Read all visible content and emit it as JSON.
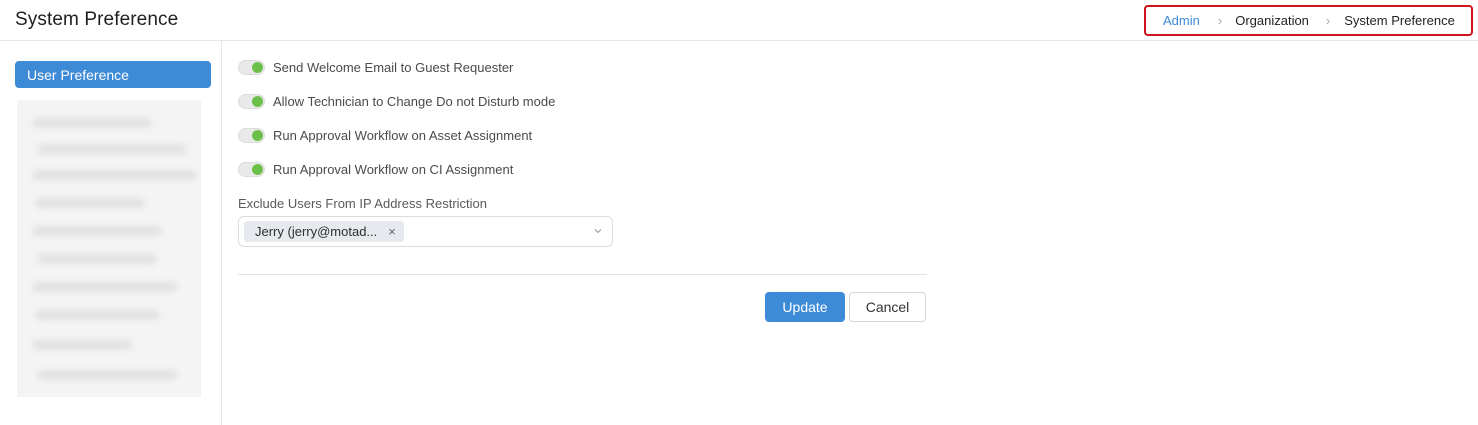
{
  "header": {
    "title": "System Preference",
    "breadcrumb": [
      "Admin",
      "Organization",
      "System Preference"
    ],
    "breadcrumb_separator": "›"
  },
  "sidebar": {
    "active_item": "User Preference"
  },
  "preferences": [
    {
      "label": "Send Welcome Email to Guest Requester",
      "enabled": true
    },
    {
      "label": "Allow Technician to Change Do not Disturb mode",
      "enabled": true
    },
    {
      "label": "Run Approval Workflow on Asset Assignment",
      "enabled": true
    },
    {
      "label": "Run Approval Workflow on CI Assignment",
      "enabled": true
    }
  ],
  "exclude_users": {
    "label": "Exclude Users From IP Address Restriction",
    "selected": [
      "Jerry (jerry@motad..."
    ],
    "remove_glyph": "×"
  },
  "actions": {
    "update_label": "Update",
    "cancel_label": "Cancel"
  },
  "colors": {
    "accent": "#3d8ad6",
    "toggle_on": "#6cc04a",
    "highlight_border": "#d0141b"
  }
}
